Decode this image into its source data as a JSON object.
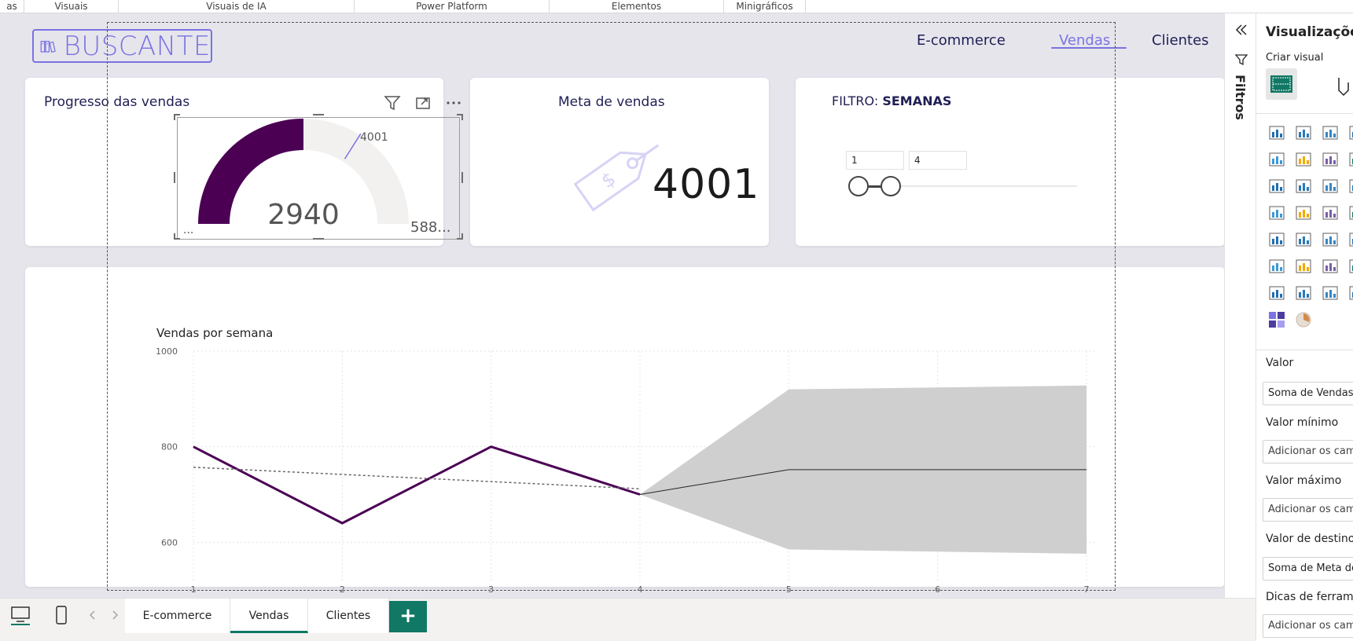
{
  "ribbon": {
    "groups": [
      "as",
      "Visuais",
      "Visuais de IA",
      "Power Platform",
      "Elementos",
      "Minigráficos"
    ]
  },
  "report": {
    "logo_text": "BUSCANTE",
    "nav": [
      "E-commerce",
      "Vendas",
      "Clientes"
    ],
    "nav_active": "Vendas",
    "gauge_card": {
      "title": "Progresso das vendas",
      "value": "2940",
      "target_label": "4001",
      "min_label": "...",
      "max_label": "588...",
      "value_fraction": 0.5,
      "target_fraction": 0.68
    },
    "meta_card": {
      "title": "Meta de vendas",
      "value": "4001"
    },
    "filter_card": {
      "title_prefix": "FILTRO:",
      "title_bold": "SEMANAS",
      "min": "1",
      "max": "4"
    }
  },
  "chart_data": {
    "type": "line",
    "title": "Vendas por semana",
    "xlabel": "",
    "ylabel": "",
    "x": [
      1,
      2,
      3,
      4,
      5,
      6,
      7
    ],
    "x_ticks": [
      "1",
      "2",
      "3",
      "4",
      "5",
      "6",
      "7"
    ],
    "y_ticks": [
      "1000",
      "800",
      "600"
    ],
    "ylim": [
      520,
      1000
    ],
    "series": [
      {
        "values": [
          800,
          640,
          800,
          700,
          null,
          null,
          null
        ]
      }
    ],
    "trend": {
      "from": [
        1,
        757
      ],
      "to": [
        4,
        712
      ]
    },
    "forecast": {
      "x": [
        4,
        5,
        7
      ],
      "center": [
        700,
        752,
        752
      ],
      "upper": [
        700,
        920,
        928
      ],
      "lower": [
        700,
        585,
        576
      ]
    },
    "grid": true,
    "colors": {
      "series": "#4b0054",
      "forecast_band": "#cfcfcf",
      "trend": "#666666"
    }
  },
  "filters_pane": {
    "label": "Filtros"
  },
  "vis_pane": {
    "title": "Visualizações",
    "subtitle": "Criar visual",
    "fields": [
      {
        "label": "Valor",
        "well": "Soma de Vendas"
      },
      {
        "label": "Valor mínimo",
        "well": "Adicionar os campos de dados aqui"
      },
      {
        "label": "Valor máximo",
        "well": "Adicionar os campos de dados aqui"
      },
      {
        "label": "Valor de destino",
        "well": "Soma de Meta de vendas"
      },
      {
        "label": "Dicas de ferramenta",
        "well": "Adicionar os campos de dados aqui"
      }
    ]
  },
  "pages": {
    "tabs": [
      "E-commerce",
      "Vendas",
      "Clientes"
    ],
    "active": "Vendas",
    "add_label": "+"
  },
  "colors": {
    "accent": "#7a73e2",
    "gauge_fill": "#4b0054",
    "gauge_bg": "#f2f1f0",
    "page_tab_active": "#117865"
  }
}
